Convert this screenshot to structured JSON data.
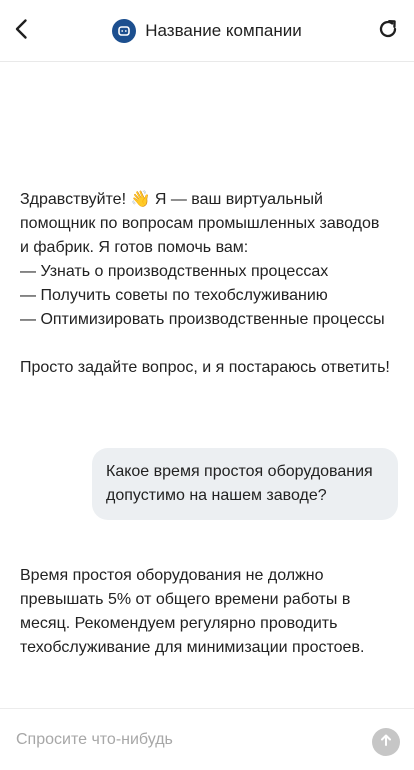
{
  "header": {
    "company_name": "Название компании",
    "back_icon": "chevron-left-icon",
    "refresh_icon": "refresh-icon",
    "logo_icon": "bot-icon",
    "logo_color": "#1c4f8f"
  },
  "messages": {
    "bot_greeting": "Здравствуйте! 👋 Я — ваш виртуальный помощник по вопросам промышленных заводов и фабрик. Я готов помочь вам:\n— Узнать о производственных процессах\n— Получить советы по техобслуживанию\n— Оптимизировать производственные процессы\n\nПросто задайте вопрос, и я постараюсь ответить!",
    "user_question": "Какое время простоя оборудования допустимо на нашем заводе?",
    "bot_answer": "Время простоя оборудования не должно превышать 5% от общего времени работы в месяц. Рекомендуем регулярно проводить техобслуживание для минимизации простоев."
  },
  "composer": {
    "placeholder": "Спросите что-нибудь",
    "value": "",
    "send_icon": "arrow-up-icon",
    "send_color": "#c6c6c6"
  },
  "colors": {
    "user_bubble": "#eceff2",
    "text": "#222222"
  }
}
